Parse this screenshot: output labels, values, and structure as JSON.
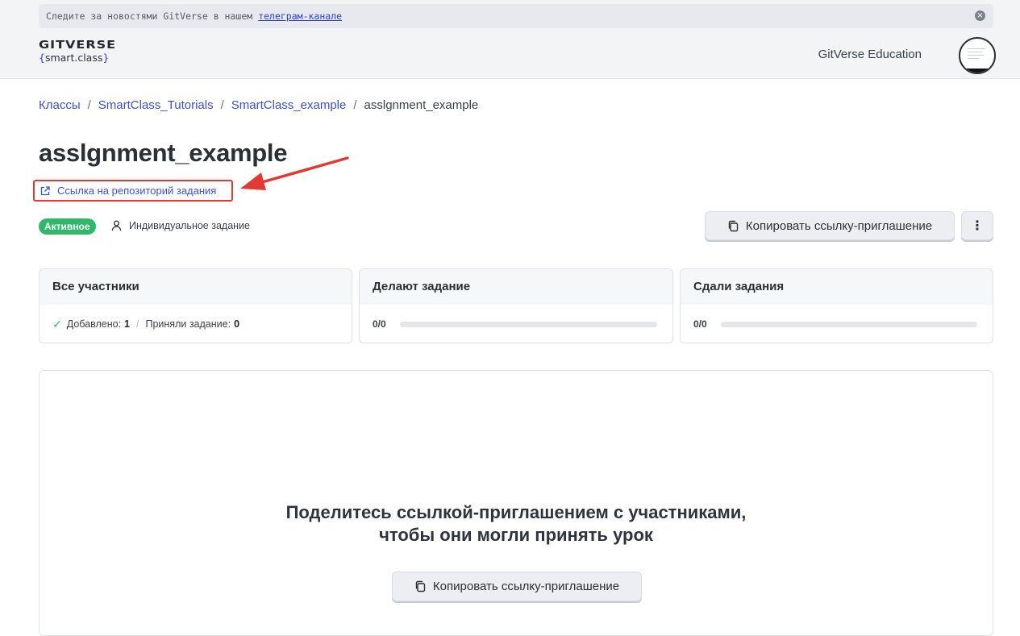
{
  "banner": {
    "text": "Следите за новостями GitVerse в нашем",
    "link": "телеграм-канале"
  },
  "logo": {
    "line1": "GITVERSE",
    "open": "{",
    "name": "smart.class",
    "close": "}"
  },
  "header": {
    "org": "GitVerse Education"
  },
  "breadcrumbs": [
    {
      "label": "Классы"
    },
    {
      "label": "SmartClass_Tutorials"
    },
    {
      "label": "SmartClass_example"
    },
    {
      "label": "asslgnment_example"
    }
  ],
  "breadcrumb_sep": "/",
  "page": {
    "title": "asslgnment_example",
    "repo_link": "Ссылка на репозиторий задания",
    "status": "Активное",
    "type": "Индивидуальное задание",
    "copy_invite": "Копировать ссылку-приглашение",
    "more": "⋮"
  },
  "cards": {
    "all": {
      "title": "Все участники",
      "added_label": "Добавлено:",
      "added_value": "1",
      "accepted_label": "Приняли задание:",
      "accepted_value": "0",
      "sep": "/"
    },
    "doing": {
      "title": "Делают задание",
      "count": "0/0",
      "progress": 0
    },
    "submitted": {
      "title": "Сдали задания",
      "count": "0/0",
      "progress": 0
    }
  },
  "empty_state": {
    "line1": "Поделитесь ссылкой-приглашением с участниками,",
    "line2": "чтобы они могли принять урок",
    "button": "Копировать ссылку-приглашение"
  },
  "colors": {
    "accent": "#3d4fcf",
    "success": "#2fb86a",
    "highlight": "#e03a32"
  }
}
